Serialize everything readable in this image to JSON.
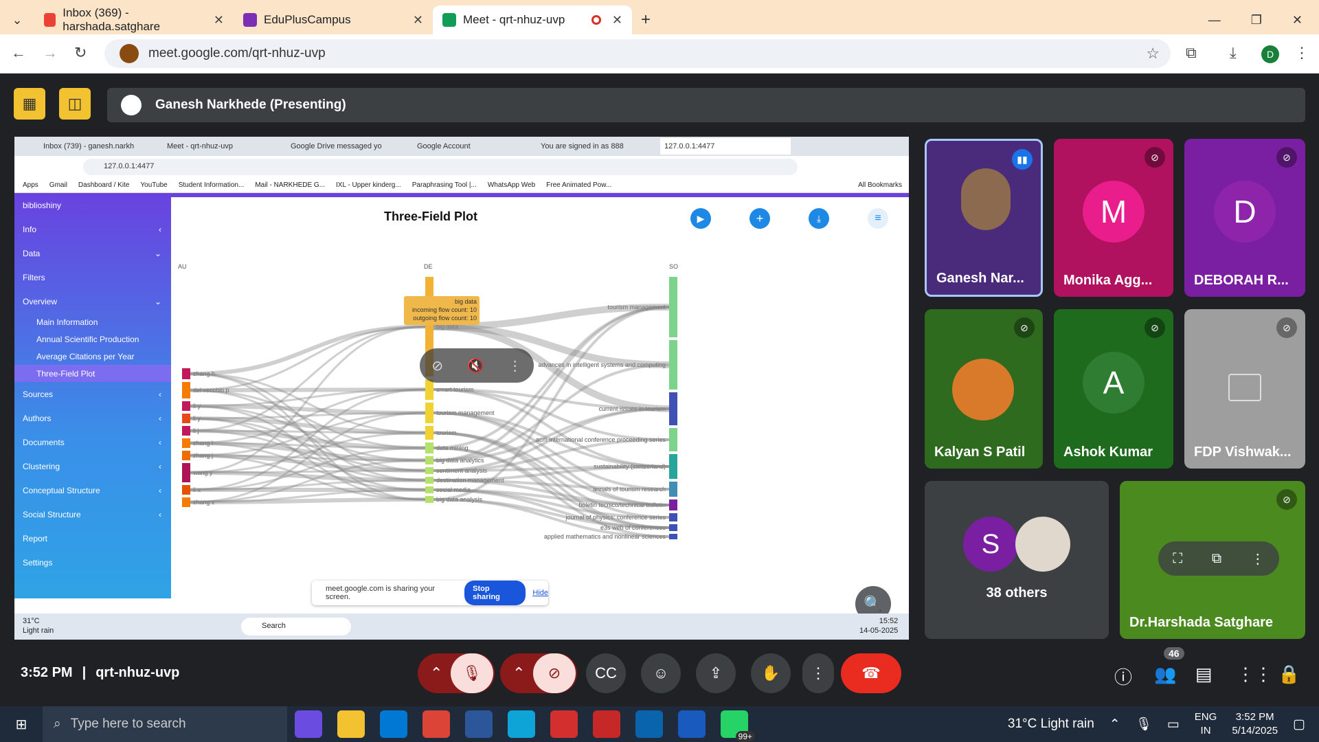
{
  "browser": {
    "tabs": [
      {
        "title": "Inbox (369) - harshada.satghare",
        "icon": "gmail-icon",
        "color": "#ea4335"
      },
      {
        "title": "EduPlusCampus",
        "icon": "app-icon",
        "color": "#7b2fb5"
      },
      {
        "title": "Meet - qrt-nhuz-uvp",
        "icon": "meet-icon",
        "color": "#0f9d58"
      }
    ],
    "url": "meet.google.com/qrt-nhuz-uvp",
    "profile_initial": "D"
  },
  "meet": {
    "presenter": "Ganesh Narkhede (Presenting)",
    "time": "3:52 PM",
    "meeting_code": "qrt-nhuz-uvp",
    "participant_count": "46",
    "others_label": "38 others",
    "tiles": [
      {
        "name": "Ganesh Nar...",
        "letter": "",
        "bg": "#4a2a7a"
      },
      {
        "name": "Monika Agg...",
        "letter": "M",
        "bg": "#b0125f",
        "circle": "#e91e8c"
      },
      {
        "name": "DEBORAH R...",
        "letter": "D",
        "bg": "#7b1fa2",
        "circle": "#8e24aa"
      },
      {
        "name": "Kalyan S Patil",
        "letter": "",
        "bg": "#2e6b1f"
      },
      {
        "name": "Ashok Kumar",
        "letter": "A",
        "bg": "#1e6b1e",
        "circle": "#2e7d32"
      },
      {
        "name": "FDP Vishwak...",
        "letter": "",
        "bg": "#9e9e9e"
      },
      {
        "name": "Dr.Harshada Satghare",
        "letter": "",
        "bg": "#4b8a1e"
      }
    ]
  },
  "shared": {
    "tabs": [
      "Inbox (739) - ganesh.narkh",
      "Meet - qrt-nhuz-uvp",
      "Google Drive messaged yo",
      "Google Account",
      "You are signed in as 888",
      "127.0.0.1:4477"
    ],
    "url": "127.0.0.1:4477",
    "bookmarks": [
      "Apps",
      "Gmail",
      "Dashboard / Kite",
      "YouTube",
      "Student Information...",
      "Mail - NARKHEDE G...",
      "IXL - Upper kinderg...",
      "Paraphrasing Tool |...",
      "WhatsApp Web",
      "Free Animated Pow...",
      "All Bookmarks"
    ],
    "sidebar": {
      "brand": "biblioshiny",
      "items": [
        "Info",
        "Data",
        "Filters",
        "Overview"
      ],
      "sub": [
        "Main Information",
        "Annual Scientific Production",
        "Average Citations per Year",
        "Three-Field Plot"
      ],
      "items2": [
        "Sources",
        "Authors",
        "Documents",
        "Clustering",
        "Conceptual Structure",
        "Social Structure",
        "Report",
        "Settings"
      ]
    },
    "plot_title": "Three-Field Plot",
    "col_au": "AU",
    "col_de": "DE",
    "col_so": "SO",
    "au_labels": [
      "zhang h",
      "del vecchio p",
      "li y",
      "li y",
      "li j",
      "zhang l",
      "zhang j",
      "wang y",
      "li x",
      "zhang z"
    ],
    "de_labels": [
      "big data",
      "smart tourism",
      "tourism management",
      "tourism",
      "data mining",
      "big data analytics",
      "sentiment analysis",
      "destination management",
      "social media",
      "big data analysis"
    ],
    "so_labels": [
      "tourism management",
      "advances in intelligent systems and computing",
      "current issues in tourism",
      "acm international conference proceeding series",
      "sustainability (switzerland)",
      "annals of tourism research",
      "boletin tecnico/technical bulletin",
      "journal of physics: conference series",
      "e3s web of conferences",
      "applied mathematics and nonlinear sciences"
    ],
    "tooltip": {
      "title": "big data",
      "value": "51.0",
      "incoming": "incoming flow count: 10",
      "outgoing": "outgoing flow count: 10"
    },
    "share_msg": "meet.google.com is sharing your screen.",
    "stop_sharing": "Stop sharing",
    "hide": "Hide",
    "weather_temp": "31°C",
    "weather_desc": "Light rain",
    "search": "Search",
    "clock": "15:52",
    "date": "14-05-2025"
  },
  "taskbar": {
    "search_placeholder": "Type here to search",
    "weather": "31°C  Light rain",
    "lang1": "ENG",
    "lang2": "IN",
    "time": "3:52 PM",
    "date": "5/14/2025",
    "badge": "99+"
  }
}
